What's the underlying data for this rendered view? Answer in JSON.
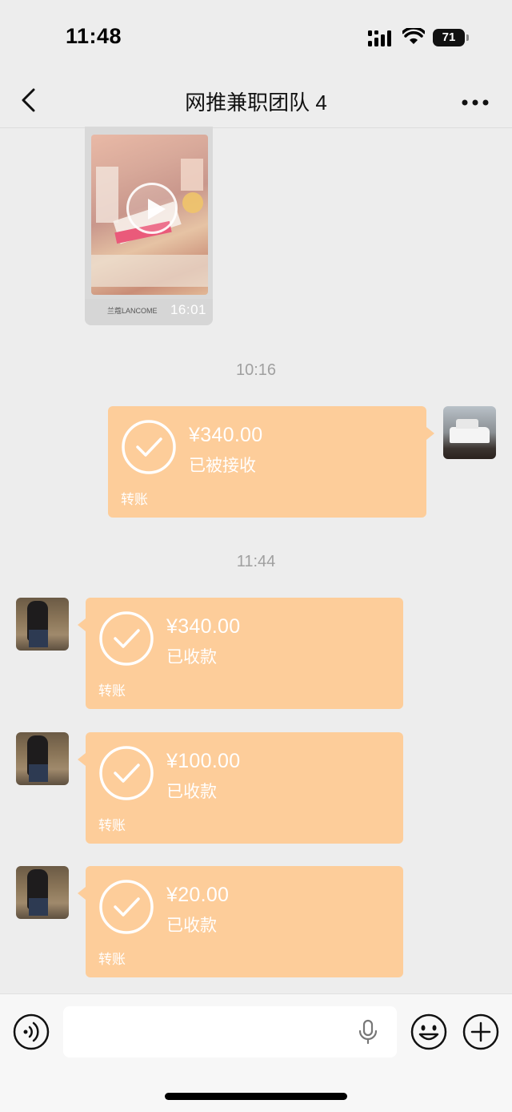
{
  "status_bar": {
    "time": "11:48",
    "battery": "71"
  },
  "header": {
    "title": "网推兼职团队 4"
  },
  "video_message": {
    "duration": "16:01",
    "brand_caption": "兰蔻LANCOME"
  },
  "messages": [
    {
      "timestamp": "10:16"
    },
    {
      "amount": "¥340.00",
      "status": "已被接收",
      "label": "转账",
      "side": "right"
    },
    {
      "timestamp": "11:44"
    },
    {
      "amount": "¥340.00",
      "status": "已收款",
      "label": "转账",
      "side": "left"
    },
    {
      "amount": "¥100.00",
      "status": "已收款",
      "label": "转账",
      "side": "left"
    },
    {
      "amount": "¥20.00",
      "status": "已收款",
      "label": "转账",
      "side": "left"
    }
  ],
  "icons": {
    "back": "chevron-left-icon",
    "more": "more-dots-icon",
    "voice": "voice-icon",
    "mic": "microphone-icon",
    "emoji": "emoji-icon",
    "plus": "plus-icon",
    "check": "check-circle-icon"
  },
  "colors": {
    "transfer_bubble": "#fdcd9a",
    "background": "#ededed",
    "timestamp": "#a0a0a0"
  }
}
